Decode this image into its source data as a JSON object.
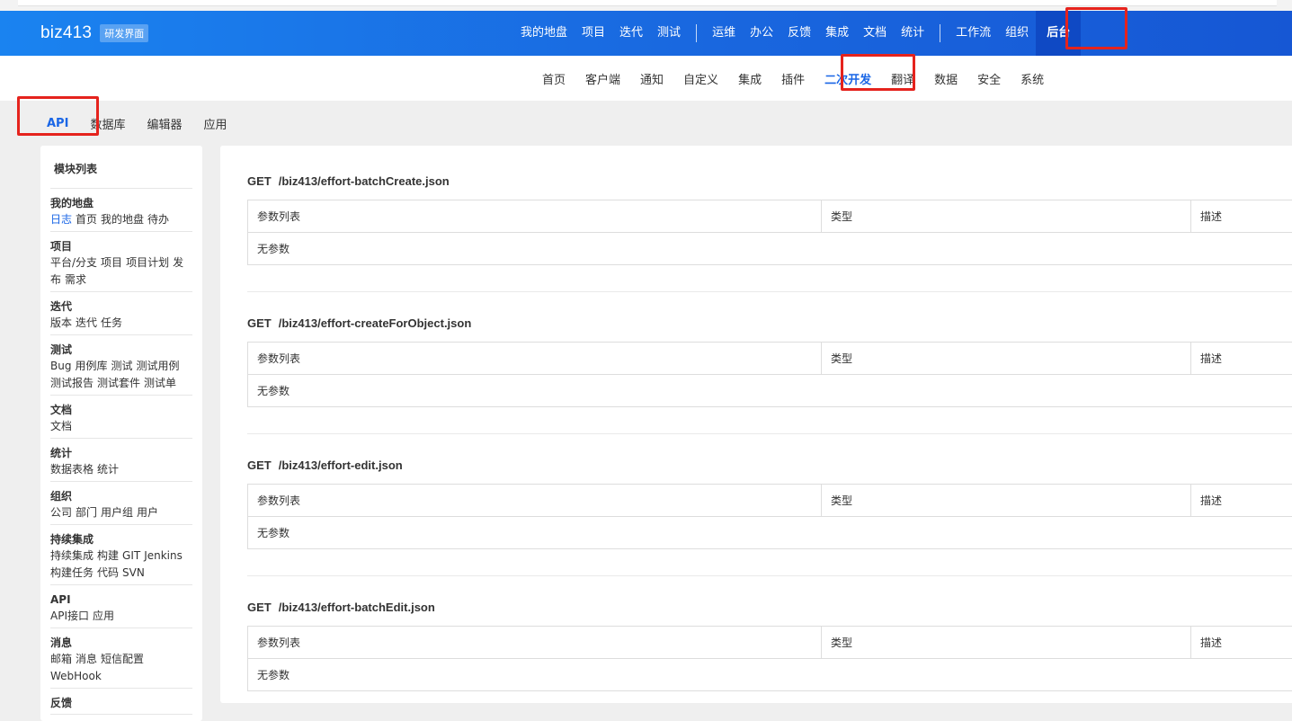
{
  "brand": {
    "name": "biz413",
    "badge": "研发界面"
  },
  "main_nav": {
    "group1": [
      "我的地盘",
      "项目",
      "迭代",
      "测试"
    ],
    "group2": [
      "运维",
      "办公",
      "反馈",
      "集成",
      "文档",
      "统计"
    ],
    "group3": [
      "工作流",
      "组织"
    ],
    "active": "后台"
  },
  "sub_nav": {
    "items": [
      "首页",
      "客户端",
      "通知",
      "自定义",
      "集成",
      "插件",
      "二次开发",
      "翻译",
      "数据",
      "安全",
      "系统"
    ],
    "active_index": 6
  },
  "tert_nav": {
    "items": [
      "API",
      "数据库",
      "编辑器",
      "应用"
    ],
    "active_index": 0
  },
  "sidebar": {
    "title": "模块列表",
    "groups": [
      {
        "title": "我的地盘",
        "links": [
          "日志",
          "首页",
          "我的地盘",
          "待办"
        ],
        "active_link": 0
      },
      {
        "title": "项目",
        "links": [
          "平台/分支",
          "项目",
          "项目计划",
          "发布",
          "需求"
        ]
      },
      {
        "title": "迭代",
        "links": [
          "版本",
          "迭代",
          "任务"
        ]
      },
      {
        "title": "测试",
        "links": [
          "Bug",
          "用例库",
          "测试",
          "测试用例",
          "测试报告",
          "测试套件",
          "测试单"
        ]
      },
      {
        "title": "文档",
        "links": [
          "文档"
        ]
      },
      {
        "title": "统计",
        "links": [
          "数据表格",
          "统计"
        ]
      },
      {
        "title": "组织",
        "links": [
          "公司",
          "部门",
          "用户组",
          "用户"
        ]
      },
      {
        "title": "持续集成",
        "links": [
          "持续集成",
          "构建",
          "GIT",
          "Jenkins",
          "构建任务",
          "代码",
          "SVN"
        ]
      },
      {
        "title": "API",
        "links": [
          "API接口",
          "应用"
        ]
      },
      {
        "title": "消息",
        "links": [
          "邮箱",
          "消息",
          "短信配置",
          "WebHook"
        ]
      },
      {
        "title": "反馈",
        "links": []
      }
    ]
  },
  "api_list": [
    {
      "method": "GET",
      "path": "/biz413/effort-batchCreate.json",
      "col_params": "参数列表",
      "col_type": "类型",
      "col_desc": "描述",
      "empty": "无参数"
    },
    {
      "method": "GET",
      "path": "/biz413/effort-createForObject.json",
      "col_params": "参数列表",
      "col_type": "类型",
      "col_desc": "描述",
      "empty": "无参数"
    },
    {
      "method": "GET",
      "path": "/biz413/effort-edit.json",
      "col_params": "参数列表",
      "col_type": "类型",
      "col_desc": "描述",
      "empty": "无参数"
    },
    {
      "method": "GET",
      "path": "/biz413/effort-batchEdit.json",
      "col_params": "参数列表",
      "col_type": "类型",
      "col_desc": "描述",
      "empty": "无参数"
    }
  ],
  "colors": {
    "accent": "#1a66e6",
    "header_start": "#1a83f0",
    "header_end": "#1657d4",
    "highlight_box": "#e5231d"
  }
}
